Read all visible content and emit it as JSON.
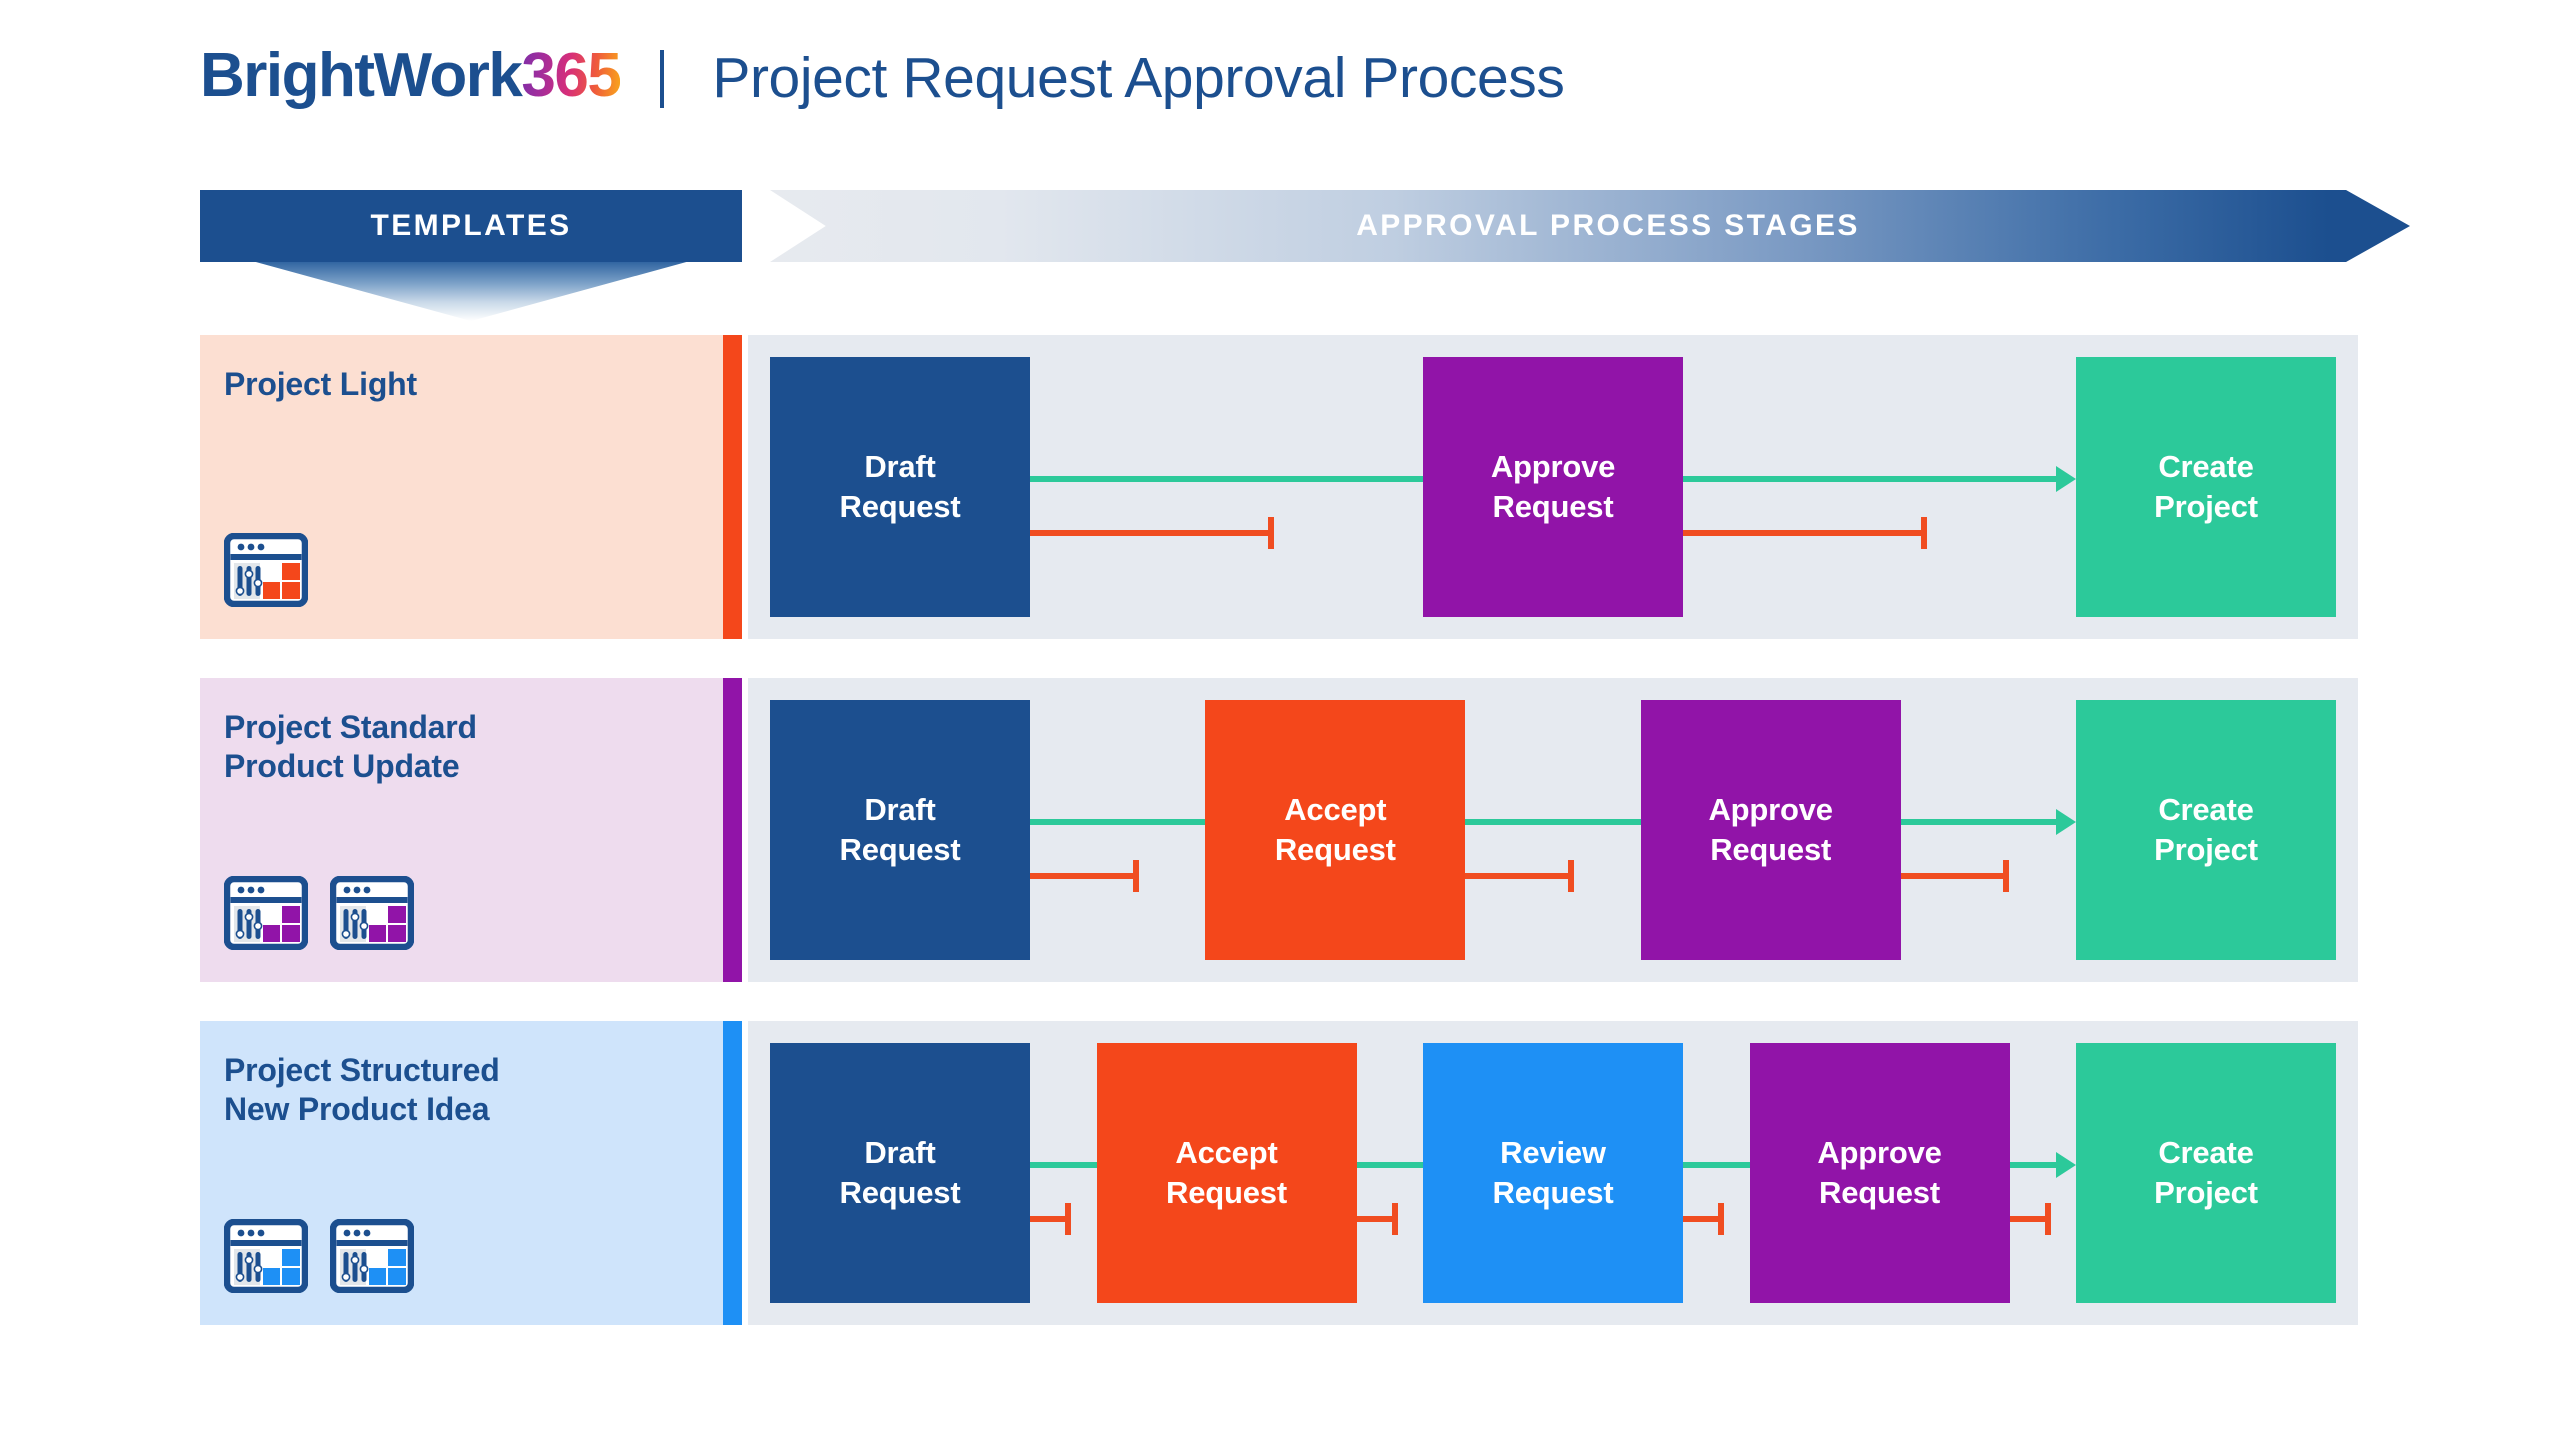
{
  "brand": {
    "logo_word": "BrightWork",
    "logo_number": "365",
    "logo_word_color": "#1C4F8F",
    "logo_gradient_from": "#7D2FA8",
    "logo_gradient_to": "#F9A81A"
  },
  "header": {
    "title": "Project Request Approval Process",
    "title_color": "#1C4F8F",
    "divider": "|"
  },
  "banners": {
    "templates": "TEMPLATES",
    "stages": "APPROVAL PROCESS STAGES",
    "templates_color": "#1C4F8F",
    "stages_gradient_from": "#E7EAEF",
    "stages_gradient_to": "#1C4F8F"
  },
  "palette": {
    "draft": "#1C4F8F",
    "accept": "#F4471B",
    "review": "#1E90F5",
    "approve": "#9114A8",
    "create": "#2CC99A",
    "approve_path": "#2CC99A",
    "reject_path": "#F04D21",
    "stage_panel_bg": "#E6EAF0"
  },
  "rows": [
    {
      "title": "Project Light",
      "panel_bg": "#FCDFD2",
      "accent": "#F4471B",
      "icon_color": "#F4471B",
      "icon_count": 1,
      "icon_name": "project-template-icon",
      "stages": [
        {
          "label": "Draft\nRequest",
          "color": "#1C4F8F",
          "name": "stage-draft-request"
        },
        {
          "label": "Approve\nRequest",
          "color": "#9114A8",
          "name": "stage-approve-request"
        },
        {
          "label": "Create\nProject",
          "color": "#2CC99A",
          "name": "stage-create-project"
        }
      ]
    },
    {
      "title": "Project Standard\nProduct Update",
      "panel_bg": "#EEDCEE",
      "accent": "#9114A8",
      "icon_color": "#9114A8",
      "icon_count": 2,
      "icon_name": "project-template-icon",
      "stages": [
        {
          "label": "Draft\nRequest",
          "color": "#1C4F8F",
          "name": "stage-draft-request"
        },
        {
          "label": "Accept\nRequest",
          "color": "#F4471B",
          "name": "stage-accept-request"
        },
        {
          "label": "Approve\nRequest",
          "color": "#9114A8",
          "name": "stage-approve-request"
        },
        {
          "label": "Create\nProject",
          "color": "#2CC99A",
          "name": "stage-create-project"
        }
      ]
    },
    {
      "title": "Project Structured\nNew Product Idea",
      "panel_bg": "#CFE4FB",
      "accent": "#1E90F5",
      "icon_color": "#1E90F5",
      "icon_count": 2,
      "icon_name": "project-template-icon",
      "stages": [
        {
          "label": "Draft\nRequest",
          "color": "#1C4F8F",
          "name": "stage-draft-request"
        },
        {
          "label": "Accept\nRequest",
          "color": "#F4471B",
          "name": "stage-accept-request"
        },
        {
          "label": "Review\nRequest",
          "color": "#1E90F5",
          "name": "stage-review-request"
        },
        {
          "label": "Approve\nRequest",
          "color": "#9114A8",
          "name": "stage-approve-request"
        },
        {
          "label": "Create\nProject",
          "color": "#2CC99A",
          "name": "stage-create-project"
        }
      ]
    }
  ]
}
